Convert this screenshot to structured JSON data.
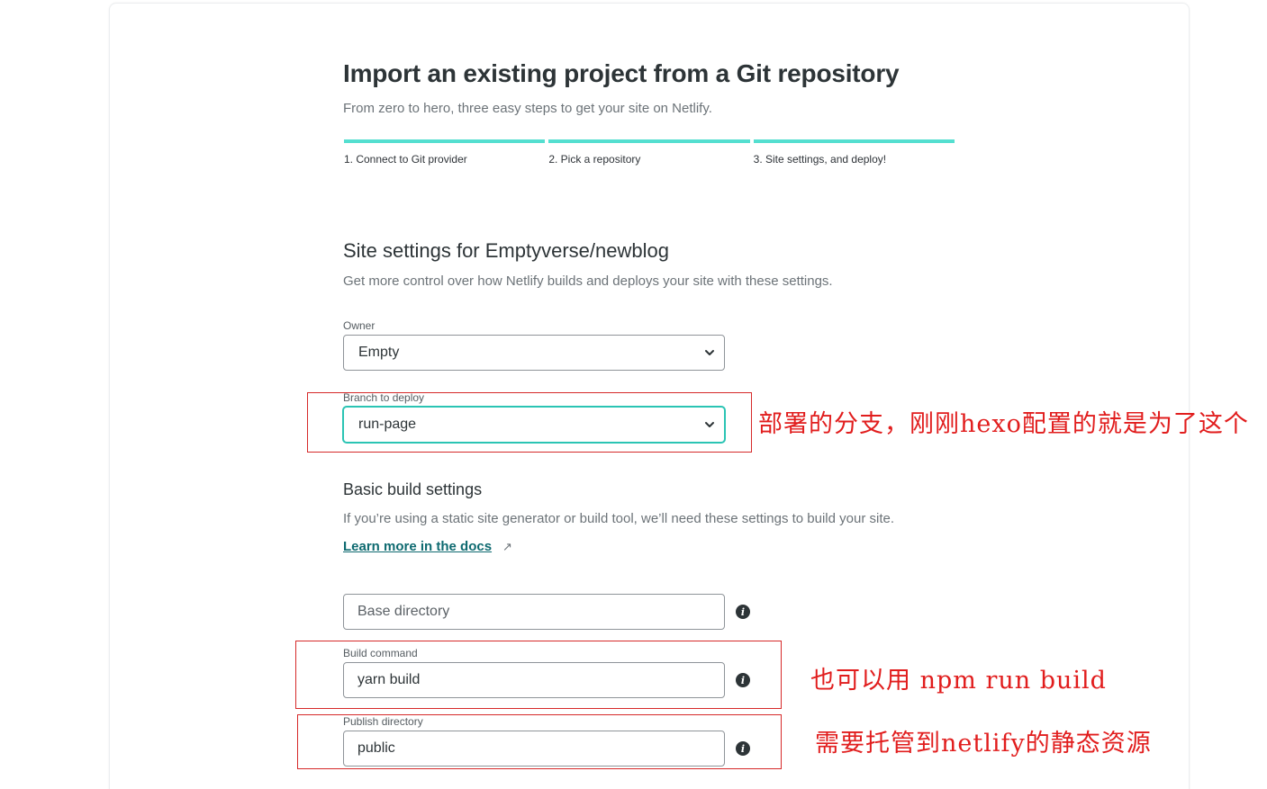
{
  "header": {
    "title": "Import an existing project from a Git repository",
    "subtitle": "From zero to hero, three easy steps to get your site on Netlify."
  },
  "steps": [
    {
      "label": "1. Connect to Git provider"
    },
    {
      "label": "2. Pick a repository"
    },
    {
      "label": "3. Site settings, and deploy!"
    }
  ],
  "site_settings": {
    "title": "Site settings for Emptyverse/newblog",
    "subtitle": "Get more control over how Netlify builds and deploys your site with these settings.",
    "owner": {
      "label": "Owner",
      "value": "Empty"
    },
    "branch": {
      "label": "Branch to deploy",
      "value": "run-page"
    }
  },
  "build": {
    "title": "Basic build settings",
    "subtitle": "If you’re using a static site generator or build tool, we’ll need these settings to build your site.",
    "docs_link": "Learn more in the docs",
    "ext_arrow": "↗",
    "base_dir": {
      "placeholder": "Base directory",
      "value": ""
    },
    "build_command": {
      "label": "Build command",
      "value": "yarn build"
    },
    "publish_dir": {
      "label": "Publish directory",
      "value": "public"
    },
    "info_glyph": "i"
  },
  "annotations": {
    "branch_note": "部署的分支，刚刚hexo配置的就是为了这个",
    "build_note": "也可以用 npm run build",
    "publish_note": "需要托管到netlify的静态资源"
  },
  "colors": {
    "accent": "#54dfd0",
    "focus": "#2bc4b4",
    "link": "#0e6a70",
    "annotation_red": "#e11d1d"
  }
}
